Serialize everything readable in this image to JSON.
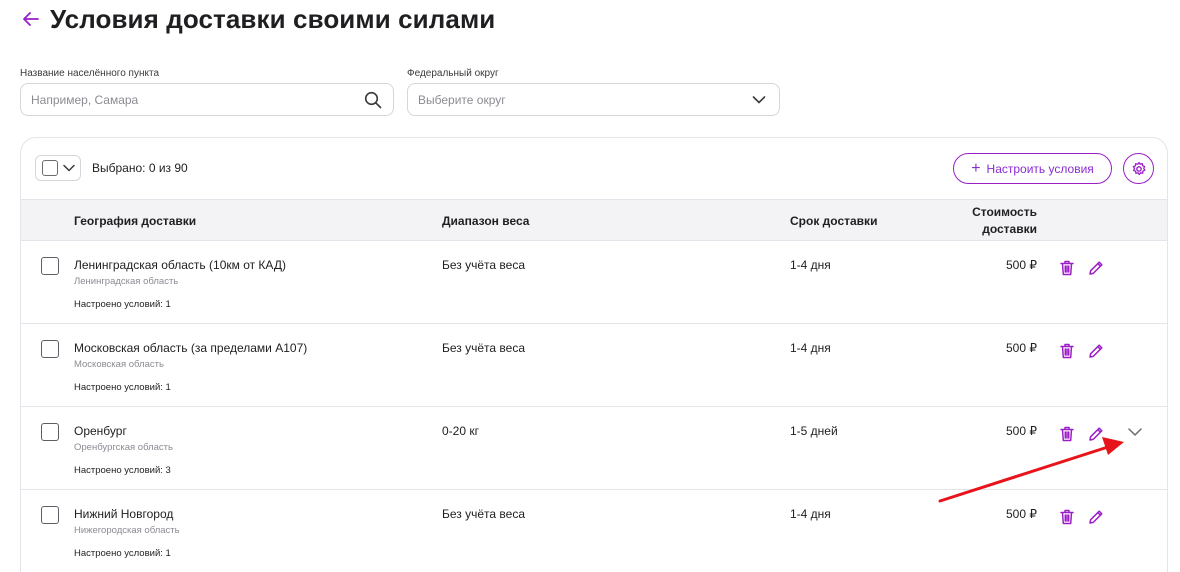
{
  "header": {
    "back_icon": "arrow-left-icon",
    "title": "Условия доставки своими силами"
  },
  "filters": {
    "city": {
      "label": "Название населённого пункта",
      "placeholder": "Например, Самара",
      "icon": "search-icon"
    },
    "district": {
      "label": "Федеральный округ",
      "placeholder": "Выберите округ",
      "icon": "chevron-down-icon"
    }
  },
  "toolbar": {
    "selected_text": "Выбрано: 0 из 90",
    "config_button": "Настроить условия",
    "settings_icon": "gear-icon"
  },
  "table": {
    "columns": {
      "geo": "География доставки",
      "weight": "Диапазон веса",
      "term": "Срок доставки",
      "cost_line1": "Стоимость",
      "cost_line2": "доставки"
    },
    "rows": [
      {
        "geo": "Ленинградская область (10км от КАД)",
        "region": "Ленинградская область",
        "conditions": "Настроено условий: 1",
        "weight": "Без учёта веса",
        "term": "1-4 дня",
        "cost": "500 ₽"
      },
      {
        "geo": "Московская область (за пределами А107)",
        "region": "Московская область",
        "conditions": "Настроено условий: 1",
        "weight": "Без учёта веса",
        "term": "1-4 дня",
        "cost": "500 ₽"
      },
      {
        "geo": "Оренбург",
        "region": "Оренбургская область",
        "conditions": "Настроено условий: 3",
        "weight": "0-20 кг",
        "term": "1-5 дней",
        "cost": "500 ₽"
      },
      {
        "geo": "Нижний Новгород",
        "region": "Нижегородская область",
        "conditions": "Настроено условий: 1",
        "weight": "Без учёта веса",
        "term": "1-4 дня",
        "cost": "500 ₽"
      }
    ]
  },
  "colors": {
    "accent": "#9b1fc7",
    "annotation_arrow": "#e8141b"
  }
}
